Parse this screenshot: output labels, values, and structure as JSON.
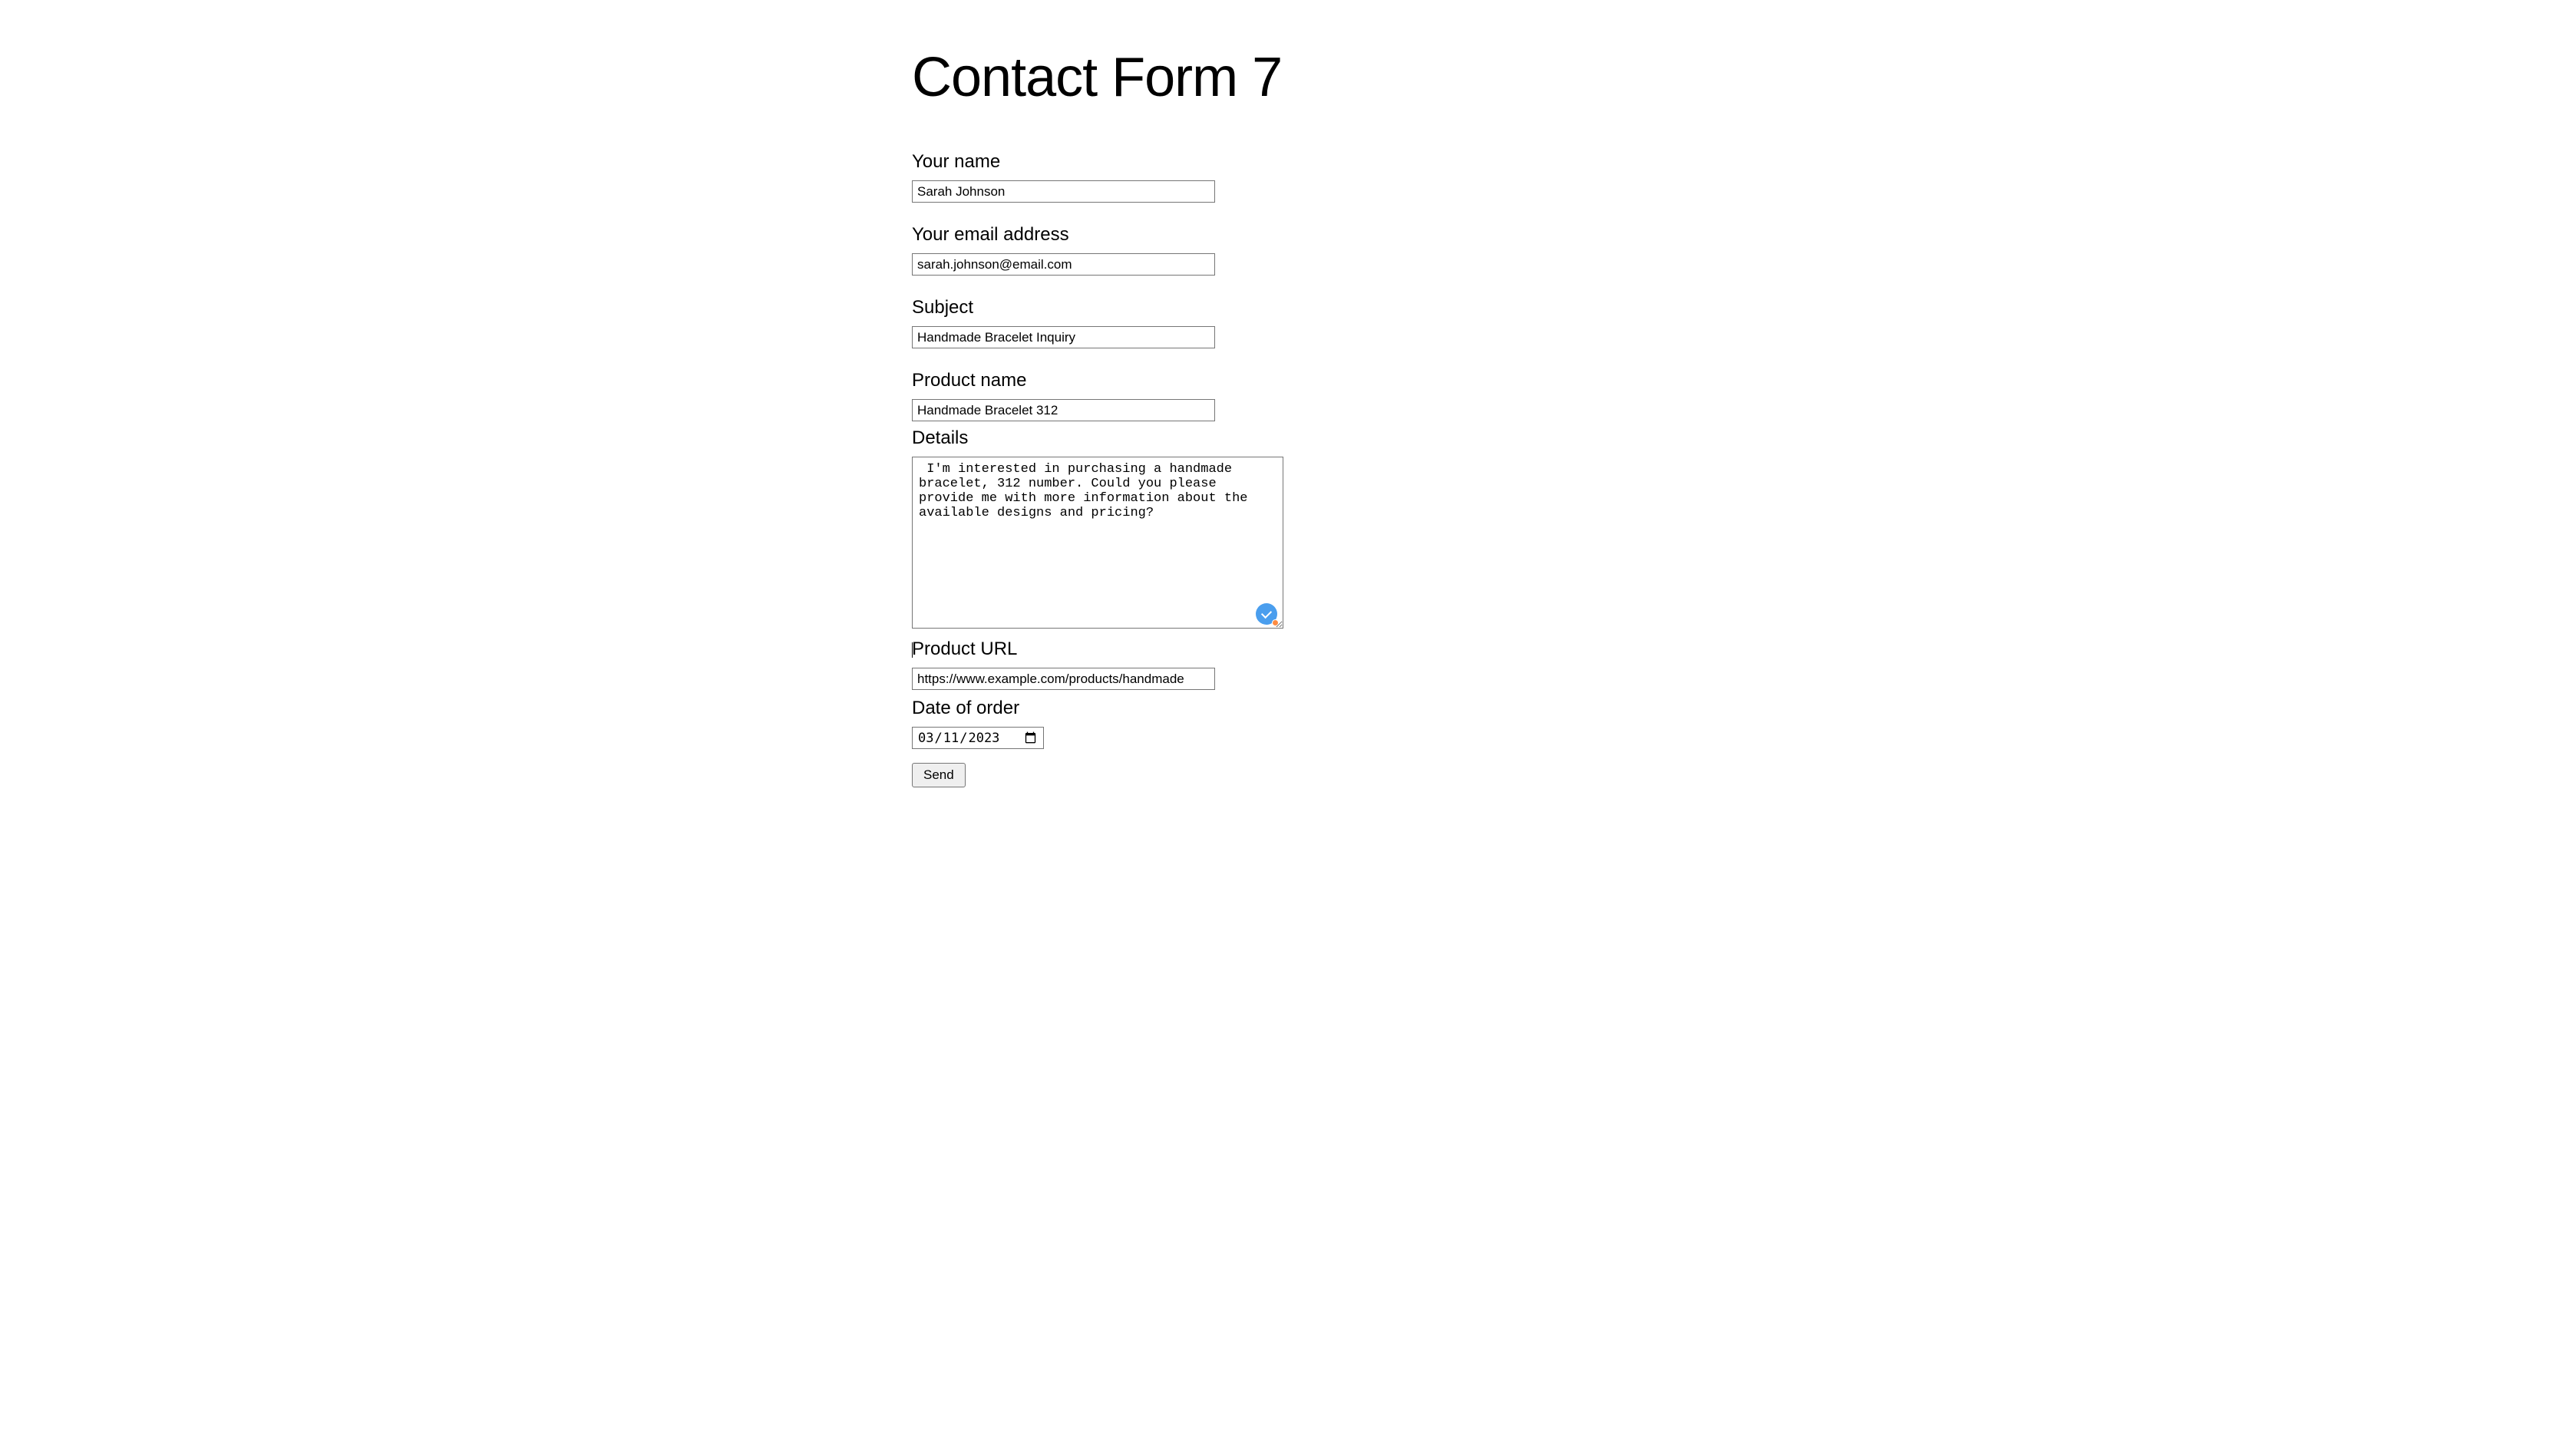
{
  "page": {
    "title": "Contact Form 7"
  },
  "form": {
    "name": {
      "label": "Your name",
      "value": "Sarah Johnson"
    },
    "email": {
      "label": "Your email address",
      "value": "sarah.johnson@email.com"
    },
    "subject": {
      "label": "Subject",
      "value": "Handmade Bracelet Inquiry"
    },
    "productName": {
      "label": "Product name",
      "value": "Handmade Bracelet 312"
    },
    "details": {
      "label": "Details",
      "value": " I'm interested in purchasing a handmade bracelet, 312 number. Could you please provide me with more information about the available designs and pricing?"
    },
    "productUrl": {
      "label": "Product URL",
      "value": "https://www.example.com/products/handmade"
    },
    "dateOfOrder": {
      "label": "Date of order",
      "value": "2023-03-11",
      "display": "03/11/2023"
    },
    "submit": {
      "label": "Send"
    }
  }
}
